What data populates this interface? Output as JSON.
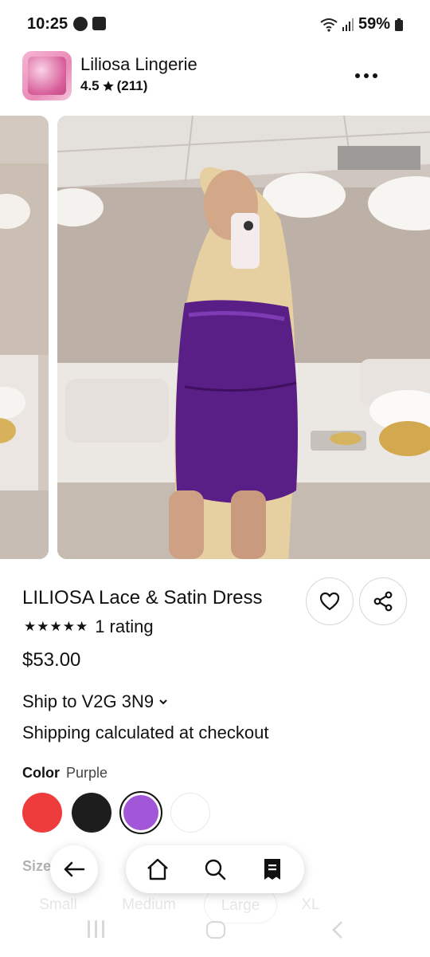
{
  "status_bar": {
    "time": "10:25",
    "battery": "59%"
  },
  "shop": {
    "name": "Liliosa Lingerie",
    "rating": "4.5",
    "review_count": "(211)"
  },
  "product": {
    "title": "LILIOSA Lace & Satin Dress",
    "stars": "★★★★★",
    "rating_text": "1 rating",
    "price": "$53.00",
    "ship_to": "Ship to V2G 3N9",
    "shipping_note": "Shipping calculated at checkout",
    "color_label": "Color",
    "color_value": "Purple",
    "colors": [
      "#ee3b3b",
      "#1d1d1d",
      "#a257d8",
      "#ffffff"
    ],
    "size_label": "Size",
    "sizes": [
      "Small",
      "Medium",
      "Large",
      "XL"
    ],
    "selected_size": "Large"
  },
  "icons": {
    "status": [
      "message-icon",
      "gallery-icon",
      "wifi-icon",
      "signal-icon",
      "battery-icon"
    ],
    "header": [
      "shop-logo",
      "more-icon"
    ],
    "product": [
      "heart-icon",
      "share-icon",
      "chevron-down-icon"
    ],
    "nav": [
      "back-arrow-icon",
      "home-icon",
      "search-icon",
      "receipt-icon"
    ]
  }
}
